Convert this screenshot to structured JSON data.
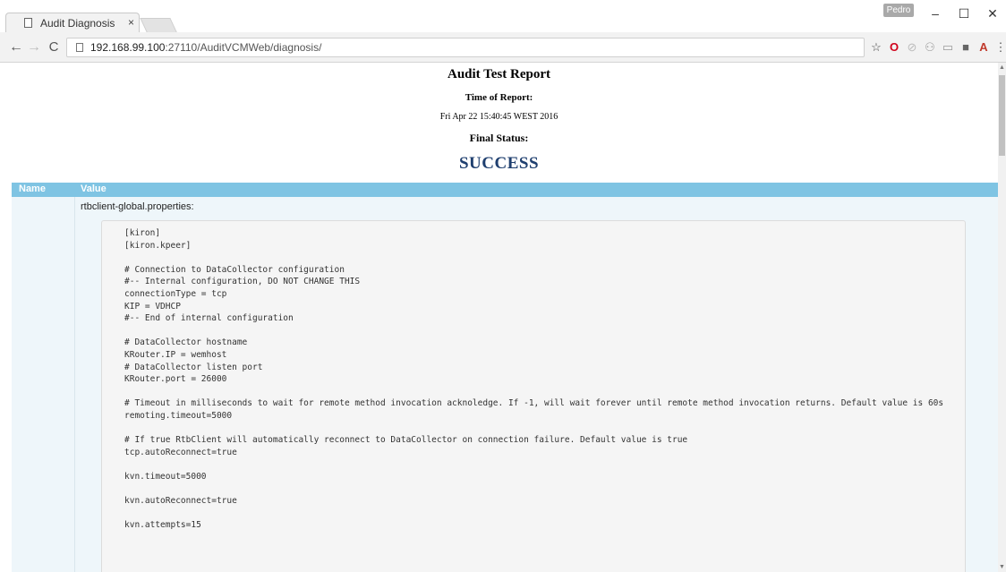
{
  "browser": {
    "tab_title": "Audit Diagnosis",
    "tab_close": "×",
    "user_badge": "Pedro",
    "url_host": "192.168.99.100",
    "url_rest": ":27110/AuditVCMWeb/diagnosis/",
    "window_controls": {
      "minimize": "–",
      "maximize": "☐",
      "close": "✕"
    },
    "extensions": [
      {
        "icon": "star-icon",
        "glyph": "☆",
        "color": "#444444"
      },
      {
        "icon": "opera-icon",
        "glyph": "O",
        "color": "#d0021b"
      },
      {
        "icon": "link-icon",
        "glyph": "⊘",
        "color": "#bbbbbb"
      },
      {
        "icon": "puzzle-icon",
        "glyph": "⚇",
        "color": "#9a9a9a"
      },
      {
        "icon": "ext-box-icon",
        "glyph": "▭",
        "color": "#9a9a9a"
      },
      {
        "icon": "square-icon",
        "glyph": "■",
        "color": "#666666"
      },
      {
        "icon": "acrobat-icon",
        "glyph": "A",
        "color": "#c0392b"
      },
      {
        "icon": "menu-icon",
        "glyph": "⋮",
        "color": "#555555"
      }
    ]
  },
  "report": {
    "title": "Audit Test Report",
    "time_label": "Time of Report:",
    "time_value": "Fri Apr 22 15:40:45 WEST 2016",
    "status_label": "Final Status:",
    "status_value": "SUCCESS"
  },
  "table": {
    "header_name": "Name",
    "header_value": "Value",
    "property_title": "rtbclient-global.properties:",
    "code_lines": [
      {
        "text": "[kiron]",
        "line": 0
      },
      {
        "text": "[kiron.kpeer]",
        "line": 1
      },
      {
        "text": "# Connection to DataCollector configuration",
        "line": 3
      },
      {
        "text": "#-- Internal configuration, DO NOT CHANGE THIS",
        "line": 4
      },
      {
        "text": "connectionType = tcp",
        "line": 5
      },
      {
        "text": "KIP = VDHCP",
        "line": 6
      },
      {
        "text": "#-- End of internal configuration",
        "line": 7
      },
      {
        "text": "# DataCollector hostname",
        "line": 9
      },
      {
        "text": "KRouter.IP = wemhost",
        "line": 10
      },
      {
        "text": "# DataCollector listen port",
        "line": 11
      },
      {
        "text": "KRouter.port = 26000",
        "line": 12
      },
      {
        "text": "# Timeout in milliseconds to wait for remote method invocation acknoledge. If -1, will wait forever until remote method invocation returns. Default value is 60s",
        "line": 14
      },
      {
        "text": "remoting.timeout=5000",
        "line": 15
      },
      {
        "text": "# If true RtbClient will automatically reconnect to DataCollector on connection failure. Default value is true",
        "line": 17
      },
      {
        "text": "tcp.autoReconnect=true",
        "line": 18
      },
      {
        "text": "kvn.timeout=5000",
        "line": 20
      },
      {
        "text": "kvn.autoReconnect=true",
        "line": 22
      },
      {
        "text": "kvn.attempts=15",
        "line": 24
      }
    ]
  }
}
